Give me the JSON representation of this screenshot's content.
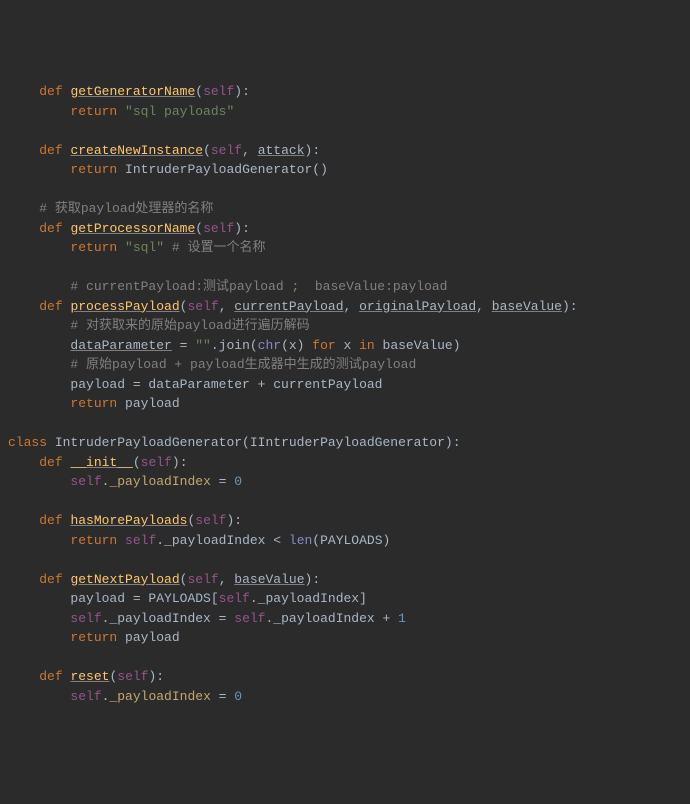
{
  "l1": {
    "kw": "def",
    "fn": "getGeneratorName",
    "self": "self"
  },
  "l2": {
    "kw": "return",
    "str": "\"sql payloads\""
  },
  "l3": {
    "kw": "def",
    "fn": "createNewInstance",
    "self": "self",
    "param": "attack"
  },
  "l4": {
    "kw": "return",
    "text": "IntruderPayloadGenerator()"
  },
  "l5": {
    "comment": "# 获取payload处理器的名称"
  },
  "l6": {
    "kw": "def",
    "fn": "getProcessorName",
    "self": "self"
  },
  "l7": {
    "kw": "return",
    "str": "\"sql\"",
    "comment": "# 设置一个名称"
  },
  "l8": {
    "comment": "# currentPayload:测试payload ;  baseValue:payload"
  },
  "l9": {
    "kw": "def",
    "fn": "processPayload",
    "self": "self",
    "p1": "currentPayload",
    "p2": "originalPayload",
    "p3": "baseValue"
  },
  "l10": {
    "comment": "# 对获取来的原始payload进行遍历解码"
  },
  "l11": {
    "var": "dataParameter",
    "eq": " = ",
    "str": "\"\"",
    "text1": ".join(",
    "builtin": "chr",
    "text2": "(x) ",
    "kw1": "for",
    "text3": " x ",
    "kw2": "in",
    "text4": " baseValue)"
  },
  "l12": {
    "comment": "# 原始payload + payload生成器中生成的测试payload"
  },
  "l13": {
    "text": "payload = dataParameter + currentPayload"
  },
  "l14": {
    "kw": "return",
    "text": "payload"
  },
  "l15": {
    "kw": "class",
    "name": "IntruderPayloadGenerator(IIntruderPayloadGenerator):"
  },
  "l16": {
    "kw": "def",
    "fn": "__init__",
    "self": "self"
  },
  "l17": {
    "self": "self",
    "dot": ".",
    "attr": "_payloadIndex",
    "eq": " = ",
    "num": "0"
  },
  "l18": {
    "kw": "def",
    "fn": "hasMorePayloads",
    "self": "self"
  },
  "l19": {
    "kw": "return",
    "self": "self",
    "text1": "._payloadIndex < ",
    "builtin": "len",
    "text2": "(PAYLOADS)"
  },
  "l20": {
    "kw": "def",
    "fn": "getNextPayload",
    "self": "self",
    "param": "baseValue"
  },
  "l21": {
    "text1": "payload = PAYLOADS[",
    "self": "self",
    "text2": "._payloadIndex]"
  },
  "l22": {
    "self1": "self",
    "text1": "._payloadIndex = ",
    "self2": "self",
    "text2": "._payloadIndex + ",
    "num": "1"
  },
  "l23": {
    "kw": "return",
    "text": "payload"
  },
  "l24": {
    "kw": "def",
    "fn": "reset",
    "self": "self"
  },
  "l25": {
    "self": "self",
    "dot": ".",
    "attr": "_payloadIndex",
    "eq": " = ",
    "num": "0"
  }
}
